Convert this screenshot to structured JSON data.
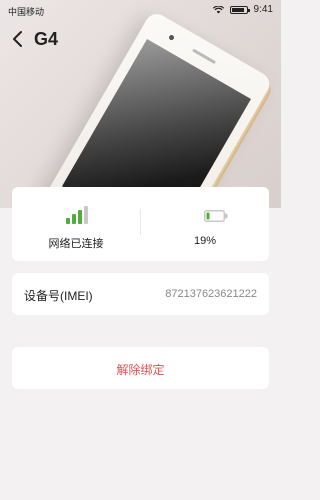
{
  "status_bar": {
    "carrier": "中国移动",
    "time": "9:41"
  },
  "nav": {
    "title": "G4"
  },
  "device_status": {
    "network_label": "网络已连接",
    "battery_label": "19%",
    "battery_level": 0.19,
    "signal_bars_active": 3,
    "signal_bars_total": 4
  },
  "imei": {
    "label": "设备号(IMEI)",
    "value": "872137623621222"
  },
  "actions": {
    "unbind_label": "解除绑定"
  },
  "colors": {
    "signal_active": "#4fae3a",
    "signal_inactive": "#c8c8c8",
    "battery_fill": "#4fae3a",
    "danger": "#e05252"
  }
}
